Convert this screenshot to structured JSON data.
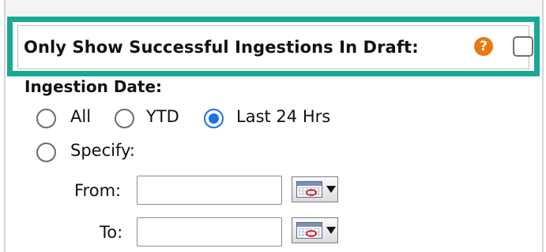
{
  "filter": {
    "draft_only_label": "Only Show Successful Ingestions In Draft:",
    "draft_only_checked": false,
    "help_glyph": "?",
    "accent_color": "#1aa794"
  },
  "ingestion_date": {
    "title": "Ingestion Date:",
    "options": [
      {
        "label": "All",
        "selected": false
      },
      {
        "label": "YTD",
        "selected": false
      },
      {
        "label": "Last 24 Hrs",
        "selected": true
      },
      {
        "label": "Specify:",
        "selected": false
      }
    ],
    "from": {
      "label": "From:",
      "value": ""
    },
    "to": {
      "label": "To:",
      "value": ""
    }
  }
}
